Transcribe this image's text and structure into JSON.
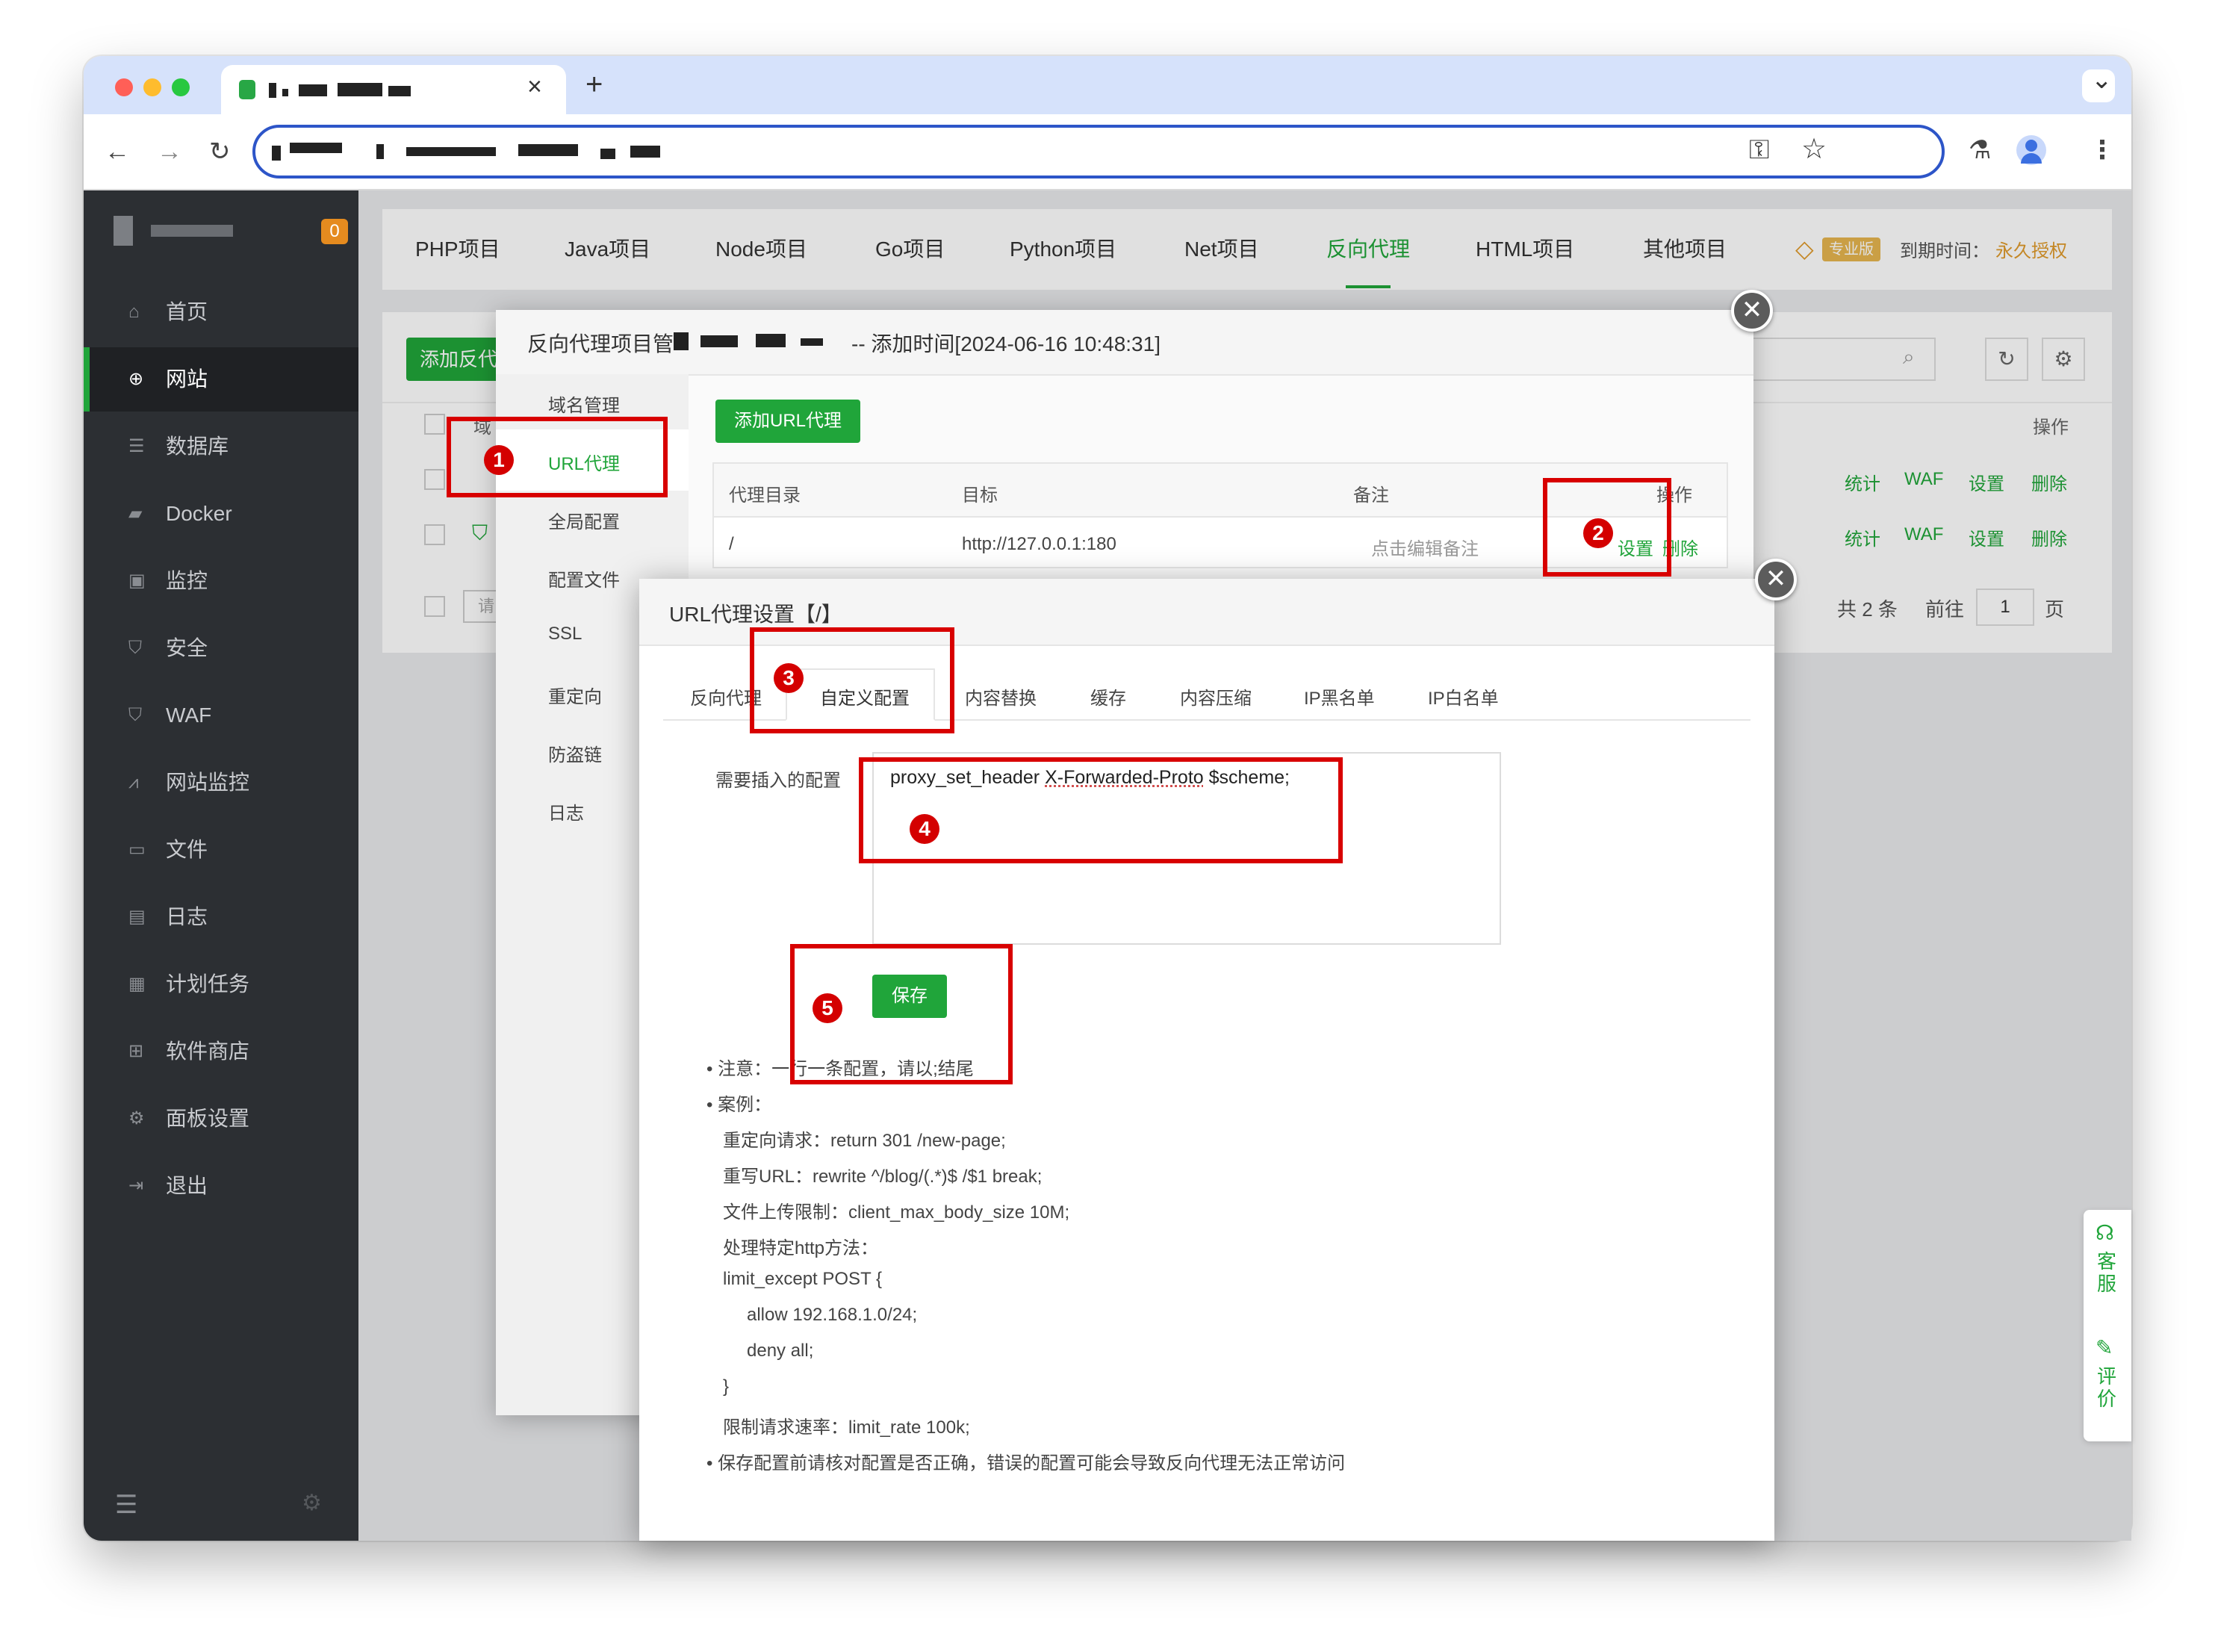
{
  "colors": {
    "accent_green": "#20a53a",
    "annotation_red": "#d80000",
    "sidebar_bg": "#2c2f33",
    "url_focus": "#2d55c8",
    "vip_gold": "#e09a2b"
  },
  "browser": {
    "tab_close": "×",
    "new_tab": "+",
    "chevron": "⌄"
  },
  "sidebar": {
    "badge": "0",
    "items": [
      {
        "label": "首页",
        "icon": "home-icon"
      },
      {
        "label": "网站",
        "icon": "globe-icon"
      },
      {
        "label": "数据库",
        "icon": "database-icon"
      },
      {
        "label": "Docker",
        "icon": "docker-icon"
      },
      {
        "label": "监控",
        "icon": "monitor-icon"
      },
      {
        "label": "安全",
        "icon": "shield-icon"
      },
      {
        "label": "WAF",
        "icon": "waf-shield-icon"
      },
      {
        "label": "网站监控",
        "icon": "chart-icon"
      },
      {
        "label": "文件",
        "icon": "folder-icon"
      },
      {
        "label": "日志",
        "icon": "log-icon"
      },
      {
        "label": "计划任务",
        "icon": "calendar-icon"
      },
      {
        "label": "软件商店",
        "icon": "grid-icon"
      },
      {
        "label": "面板设置",
        "icon": "gear-icon"
      },
      {
        "label": "退出",
        "icon": "logout-icon"
      }
    ]
  },
  "topnav": {
    "tabs": [
      "PHP项目",
      "Java项目",
      "Node项目",
      "Go项目",
      "Python项目",
      "Net项目",
      "反向代理",
      "HTML项目",
      "其他项目"
    ],
    "active": "反向代理",
    "vip_label": "专业版",
    "expire_label": "到期时间：",
    "expire_value": "永久授权"
  },
  "list": {
    "add_button": "添加反代",
    "col_domain": "域",
    "col_ops": "操作",
    "row_ops": [
      "统计",
      "WAF",
      "设置",
      "删除"
    ],
    "search_placeholder": "请",
    "total": "共 2 条",
    "goto": "前往",
    "page": "1",
    "page_unit": "页",
    "waf_badge": "WAF"
  },
  "panel": {
    "title": "反向代理项目管",
    "title_suffix": "-- 添加时间[2024-06-16 10:48:31]",
    "menu": [
      "域名管理",
      "URL代理",
      "全局配置",
      "配置文件",
      "SSL",
      "重定向",
      "防盗链",
      "日志"
    ],
    "active_menu": "URL代理",
    "add_url_button": "添加URL代理",
    "table_headers": [
      "代理目录",
      "目标",
      "备注",
      "操作"
    ],
    "row": {
      "dir": "/",
      "target": "http://127.0.0.1:180",
      "note": "点击编辑备注",
      "op_set": "设置",
      "op_del": "删除"
    }
  },
  "modal": {
    "title": "URL代理设置【/】",
    "tabs": [
      "反向代理",
      "自定义配置",
      "内容替换",
      "缓存",
      "内容压缩",
      "IP黑名单",
      "IP白名单"
    ],
    "active_tab": "自定义配置",
    "field_label": "需要插入的配置",
    "config_prefix": "proxy_set_header ",
    "config_underlined": "X-Forwarded-Proto",
    "config_suffix": " $scheme;",
    "save_button": "保存",
    "notes": [
      "注意：一行一条配置，请以;结尾",
      "案例：",
      "重定向请求：return 301 /new-page;",
      "重写URL：rewrite ^/blog/(.*)$ /$1 break;",
      "文件上传限制：client_max_body_size 10M;",
      "处理特定http方法：",
      "limit_except POST {",
      "allow 192.168.1.0/24;",
      "deny all;",
      "}",
      "限制请求速率：limit_rate 100k;",
      "保存配置前请核对配置是否正确，错误的配置可能会导致反向代理无法正常访问"
    ]
  },
  "annotations": [
    "1",
    "2",
    "3",
    "4",
    "5"
  ],
  "floating": {
    "service": "客服",
    "review": "评价"
  }
}
